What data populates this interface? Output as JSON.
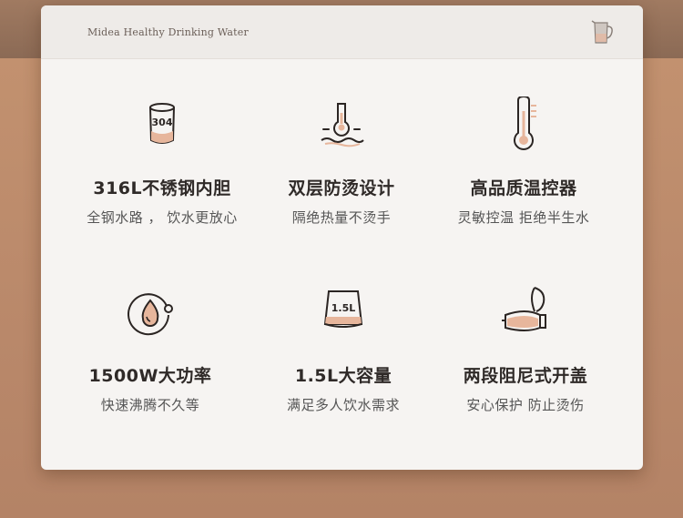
{
  "header": {
    "brand": "Midea Healthy Drinking Water"
  },
  "features": [
    {
      "title": "316L不锈钢内胆",
      "subtitle": "全钢水路 ， 饮水更放心",
      "icon": "304-cup-icon",
      "badge": "304"
    },
    {
      "title": "双层防烫设计",
      "subtitle": "隔绝热量不烫手",
      "icon": "anti-scald-icon"
    },
    {
      "title": "高品质温控器",
      "subtitle": "灵敏控温 拒绝半生水",
      "icon": "thermometer-icon"
    },
    {
      "title": "1500W大功率",
      "subtitle": "快速沸腾不久等",
      "icon": "power-drop-icon"
    },
    {
      "title": "1.5L大容量",
      "subtitle": "满足多人饮水需求",
      "icon": "capacity-icon",
      "badge": "1.5L"
    },
    {
      "title": "两段阻尼式开盖",
      "subtitle": "安心保护 防止烫伤",
      "icon": "lid-open-icon"
    }
  ],
  "colors": {
    "accent": "#e7b69c",
    "icon_stroke": "#2b2523",
    "background": "#b8876a"
  }
}
